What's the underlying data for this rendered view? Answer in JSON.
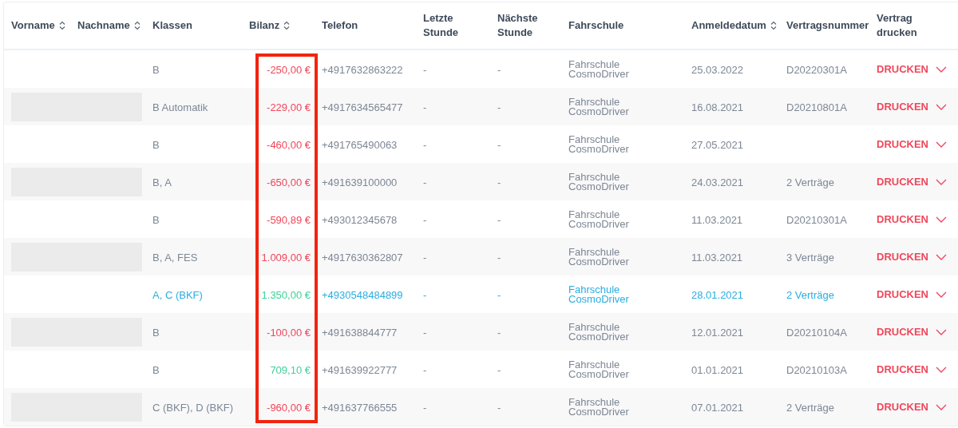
{
  "table": {
    "columns": [
      {
        "label": "Vorname",
        "sortable": true,
        "framed": false
      },
      {
        "label": "Nachname",
        "sortable": true,
        "framed": false
      },
      {
        "label": "Klassen",
        "sortable": false,
        "framed": false
      },
      {
        "label": "Bilanz",
        "sortable": true,
        "framed": true
      },
      {
        "label": "Telefon",
        "sortable": false,
        "framed": false
      },
      {
        "label": "Letzte Stunde",
        "sortable": false,
        "framed": false
      },
      {
        "label": "Nächste Stunde",
        "sortable": false,
        "framed": false
      },
      {
        "label": "Fahrschule",
        "sortable": false,
        "framed": false
      },
      {
        "label": "Anmeldedatum",
        "sortable": true,
        "framed": false
      },
      {
        "label": "Vertragsnummer",
        "sortable": false,
        "framed": false
      },
      {
        "label": "Vertrag drucken",
        "sortable": false,
        "framed": false
      }
    ],
    "rows": [
      {
        "redacted": false,
        "highlighted": false,
        "classes": "B",
        "balance": {
          "text": "-250,00 €",
          "color": "#f0475a"
        },
        "phone": "+4917632863222",
        "last_lesson": "-",
        "next_lesson": "-",
        "school": "Fahrschule CosmoDriver",
        "registered": "25.03.2022",
        "contract": "D20220301A",
        "action": "DRUCKEN"
      },
      {
        "redacted": true,
        "highlighted": false,
        "classes": "B Automatik",
        "balance": {
          "text": "-229,00 €",
          "color": "#f0475a"
        },
        "phone": "+4917634565477",
        "last_lesson": "-",
        "next_lesson": "-",
        "school": "Fahrschule CosmoDriver",
        "registered": "16.08.2021",
        "contract": "D20210801A",
        "action": "DRUCKEN"
      },
      {
        "redacted": false,
        "highlighted": false,
        "classes": "B",
        "balance": {
          "text": "-460,00 €",
          "color": "#f0475a"
        },
        "phone": "+491765490063",
        "last_lesson": "-",
        "next_lesson": "-",
        "school": "Fahrschule CosmoDriver",
        "registered": "27.05.2021",
        "action": "DRUCKEN"
      },
      {
        "redacted": true,
        "highlighted": false,
        "classes": "B, A",
        "balance": {
          "text": "-650,00 €",
          "color": "#f0475a"
        },
        "phone": "+491639100000",
        "last_lesson": "-",
        "next_lesson": "-",
        "school": "Fahrschule CosmoDriver",
        "registered": "24.03.2021",
        "contract": "2 Verträge",
        "action": "DRUCKEN"
      },
      {
        "redacted": false,
        "highlighted": false,
        "classes": "B",
        "balance": {
          "text": "-590,89 €",
          "color": "#f0475a"
        },
        "phone": "+493012345678",
        "last_lesson": "-",
        "next_lesson": "-",
        "school": "Fahrschule CosmoDriver",
        "registered": "11.03.2021",
        "contract": "D20210301A",
        "action": "DRUCKEN"
      },
      {
        "redacted": true,
        "highlighted": false,
        "classes": "B, A, FES",
        "balance": {
          "text": "1.009,00 €",
          "color": "#f0475a"
        },
        "phone": "+4917630362807",
        "last_lesson": "-",
        "next_lesson": "-",
        "school": "Fahrschule CosmoDriver",
        "registered": "11.03.2021",
        "contract": "3 Verträge",
        "action": "DRUCKEN"
      },
      {
        "redacted": false,
        "highlighted": true,
        "classes": "A, C (BKF)",
        "balance": {
          "text": "1.350,00 €",
          "color": "#3ed29a"
        },
        "phone": "+4930548484899",
        "last_lesson": "-",
        "next_lesson": "-",
        "school": "Fahrschule CosmoDriver",
        "registered": "28.01.2021",
        "contract": "2 Verträge",
        "action": "DRUCKEN"
      },
      {
        "redacted": true,
        "highlighted": false,
        "classes": "B",
        "balance": {
          "text": "-100,00 €",
          "color": "#f0475a"
        },
        "phone": "+491638844777",
        "last_lesson": "-",
        "next_lesson": "-",
        "school": "Fahrschule CosmoDriver",
        "registered": "12.01.2021",
        "contract": "D20210104A",
        "action": "DRUCKEN"
      },
      {
        "redacted": false,
        "highlighted": false,
        "classes": "B",
        "balance": {
          "text": "709,10 €",
          "color": "#3ed29a"
        },
        "phone": "+491639922777",
        "last_lesson": "-",
        "next_lesson": "-",
        "school": "Fahrschule CosmoDriver",
        "registered": "01.01.2021",
        "contract": "D20210103A",
        "action": "DRUCKEN"
      },
      {
        "redacted": true,
        "highlighted": false,
        "classes": "C (BKF), D (BKF)",
        "balance": {
          "text": "-960,00 €",
          "color": "#f0475a"
        },
        "phone": "+491637766555",
        "last_lesson": "-",
        "next_lesson": "-",
        "school": "Fahrschule CosmoDriver",
        "registered": "07.01.2021",
        "contract": "2 Verträge",
        "action": "DRUCKEN"
      }
    ]
  }
}
